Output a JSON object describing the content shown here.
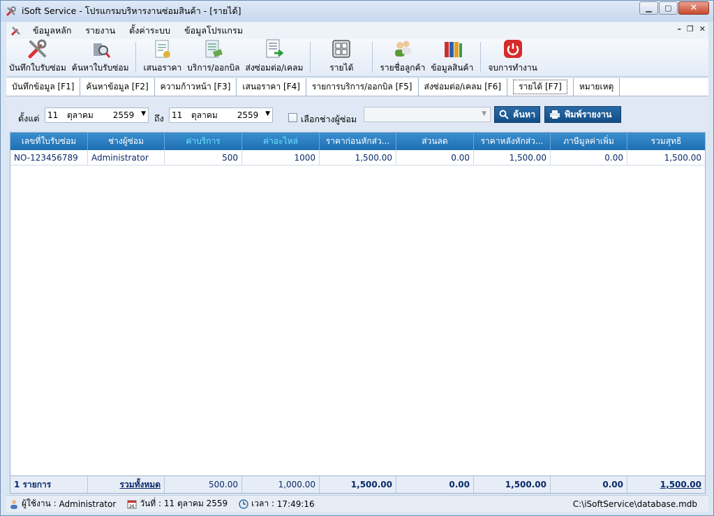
{
  "window": {
    "title": "iSoft Service - โปรแกรมบริหารงานซ่อมสินค้า - [รายได้]",
    "controls": [
      "minimize",
      "maximize",
      "close"
    ]
  },
  "menu": {
    "items": [
      "ข้อมูลหลัก",
      "รายงาน",
      "ตั้งค่าระบบ",
      "ข้อมูลโปรแกรม"
    ]
  },
  "toolbar": {
    "items": [
      {
        "label": "บันทึกใบรับซ่อม",
        "icon": "tools-icon"
      },
      {
        "label": "ค้นหาใบรับซ่อม",
        "icon": "search-tool-icon"
      },
      {
        "label": "เสนอราคา",
        "icon": "quotation-icon"
      },
      {
        "label": "บริการ/ออกบิล",
        "icon": "invoice-icon"
      },
      {
        "label": "ส่งซ่อมต่อ/เคลม",
        "icon": "forward-icon"
      },
      {
        "label": "รายได้",
        "icon": "calculator-icon"
      },
      {
        "label": "รายชื่อลูกค้า",
        "icon": "customers-icon"
      },
      {
        "label": "ข้อมูลสินค้า",
        "icon": "binders-icon"
      },
      {
        "label": "จบการทำงาน",
        "icon": "power-icon"
      }
    ]
  },
  "tabs": [
    {
      "label": "บันทึกข้อมูล [F1]",
      "active": false
    },
    {
      "label": "ค้นหาข้อมูล [F2]",
      "active": false
    },
    {
      "label": "ความก้าวหน้า [F3]",
      "active": false
    },
    {
      "label": "เสนอราคา [F4]",
      "active": false
    },
    {
      "label": "รายการบริการ/ออกบิล [F5]",
      "active": false
    },
    {
      "label": "ส่งซ่อมต่อ/เคลม [F6]",
      "active": false
    },
    {
      "label": "รายได้ [F7]",
      "active": true
    },
    {
      "label": "หมายเหตุ",
      "active": false
    }
  ],
  "filter": {
    "from_label": "ตั้งแต่",
    "from_day": "11",
    "from_month": "ตุลาคม",
    "from_year": "2559",
    "to_label": "ถึง",
    "to_day": "11",
    "to_month": "ตุลาคม",
    "to_year": "2559",
    "technician_checkbox_label": "เลือกช่างผู้ซ่อม",
    "technician_value": "",
    "search_button": "ค้นหา",
    "print_button": "พิมพ์รายงาน"
  },
  "grid": {
    "columns": [
      "เลขที่ใบรับซ่อม",
      "ช่างผู้ซ่อม",
      "ค่าบริการ",
      "ค่าอะไหล่",
      "ราคาก่อนหักส่ว...",
      "ส่วนลด",
      "ราคาหลังหักส่ว...",
      "ภาษีมูลค่าเพิ่ม",
      "รวมสุทธิ"
    ],
    "rows": [
      [
        "NO-123456789",
        "Administrator",
        "500",
        "1000",
        "1,500.00",
        "0.00",
        "1,500.00",
        "0.00",
        "1,500.00"
      ]
    ],
    "footer": {
      "count_label": "1  รายการ",
      "total_label": "รวมทั้งหมด",
      "service": "500.00",
      "parts": "1,000.00",
      "before_discount": "1,500.00",
      "discount": "0.00",
      "after_discount": "1,500.00",
      "vat": "0.00",
      "net": "1,500.00"
    }
  },
  "status": {
    "user_label": "ผู้ใช้งาน :",
    "user": "Administrator",
    "date_label": "วันที่ :",
    "date": "11 ตุลาคม 2559",
    "time_label": "เวลา :",
    "time": "17:49:16",
    "path": "C:\\iSoftService\\database.mdb"
  },
  "colors": {
    "header_blue": "#1f6fb2",
    "header_highlight_text": "#6de3ff",
    "button_blue": "#144f86",
    "cell_text": "#0a2a6a"
  }
}
